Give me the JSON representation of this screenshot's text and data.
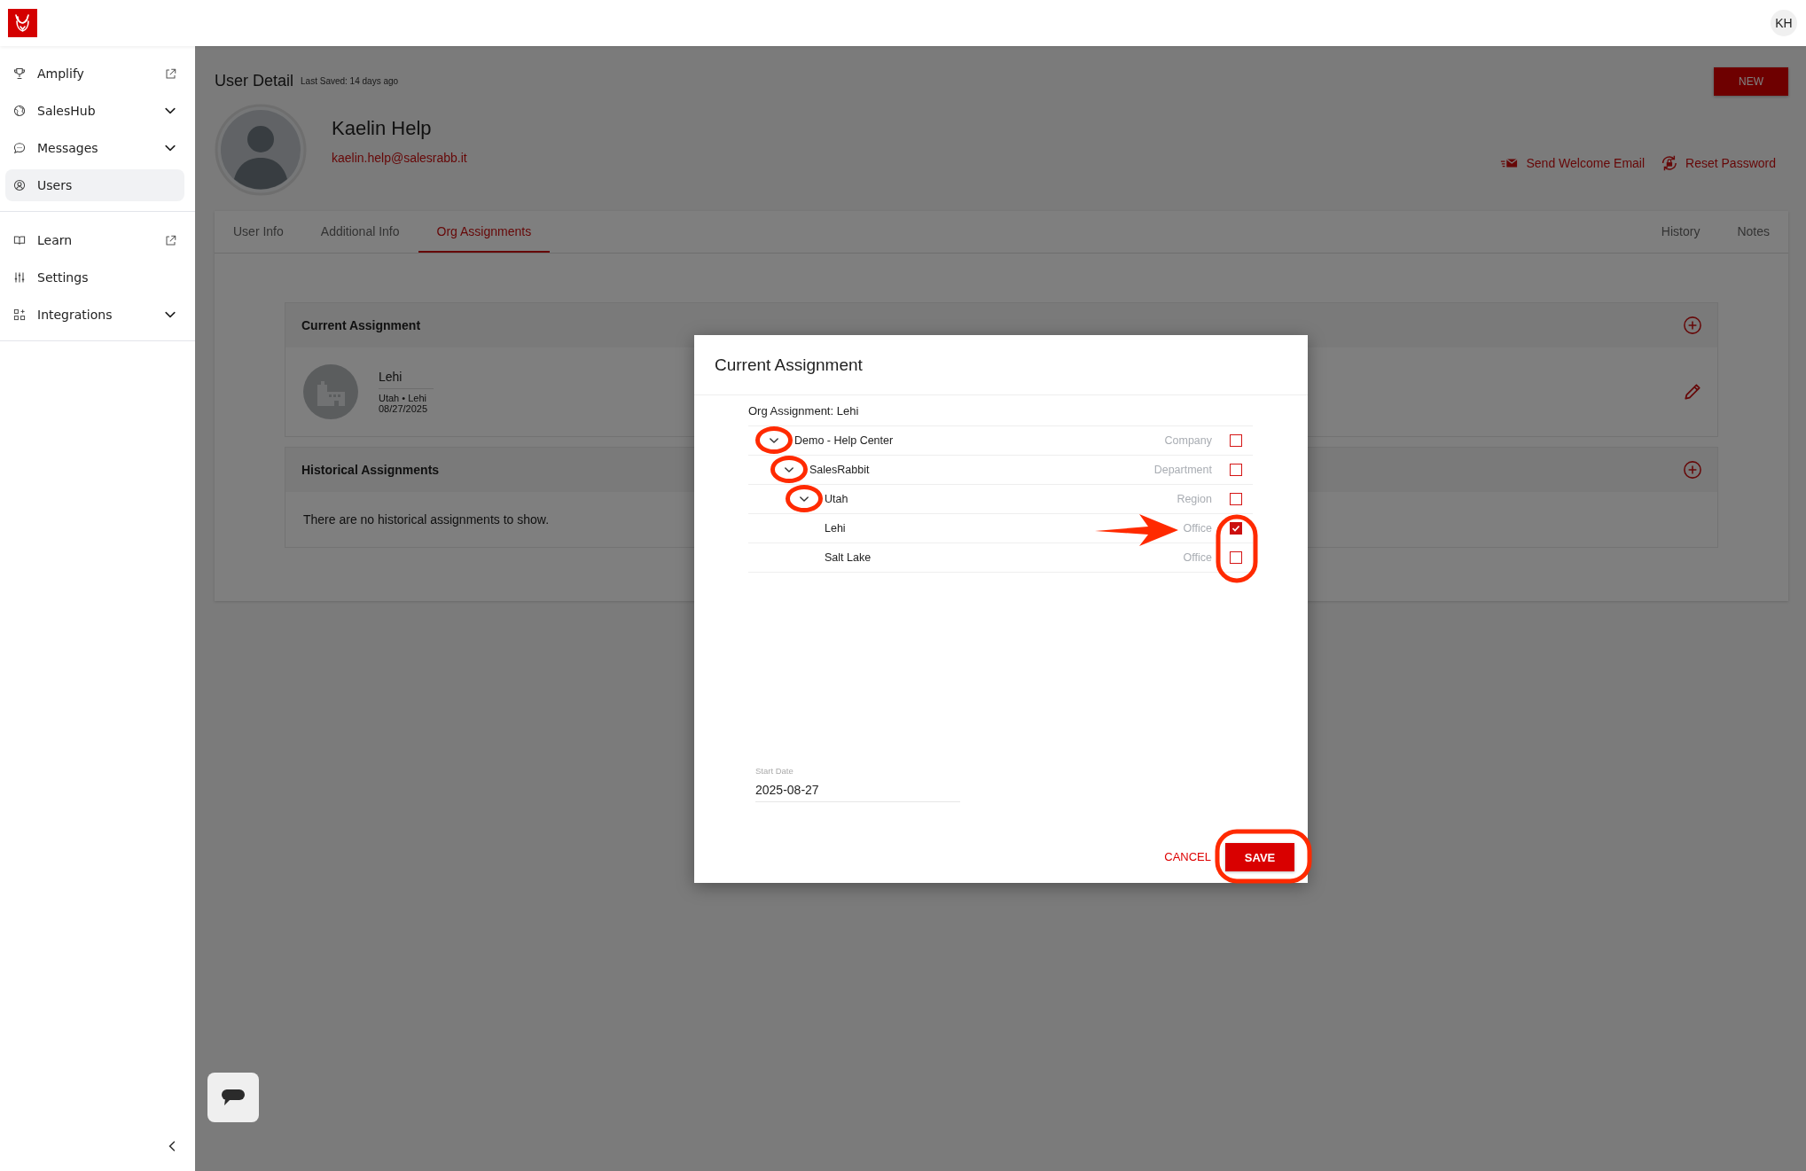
{
  "top_bar": {
    "avatar_initials": "KH"
  },
  "sidebar": {
    "groups": [
      {
        "items": [
          {
            "label": "Amplify",
            "kind": "external",
            "selected": false
          },
          {
            "label": "SalesHub",
            "kind": "expand",
            "selected": false
          },
          {
            "label": "Messages",
            "kind": "expand",
            "selected": false
          },
          {
            "label": "Users",
            "kind": "plain",
            "selected": true
          }
        ]
      },
      {
        "items": [
          {
            "label": "Learn",
            "kind": "external",
            "selected": false
          },
          {
            "label": "Settings",
            "kind": "plain",
            "selected": false
          },
          {
            "label": "Integrations",
            "kind": "expand",
            "selected": false
          }
        ]
      }
    ]
  },
  "page": {
    "title": "User Detail",
    "last_saved": "Last Saved:  14 days ago",
    "new_button": "NEW"
  },
  "user": {
    "name": "Kaelin Help",
    "email": "kaelin.help@salesrabb.it"
  },
  "actions": [
    "Send Welcome Email",
    "Reset Password"
  ],
  "tabs": {
    "left": [
      {
        "label": "User Info",
        "selected": false
      },
      {
        "label": "Additional Info",
        "selected": false
      },
      {
        "label": "Org Assignments",
        "selected": true
      }
    ],
    "right": [
      {
        "label": "History",
        "selected": false
      },
      {
        "label": "Notes",
        "selected": false
      }
    ]
  },
  "current_assignment": {
    "title": "Current Assignment",
    "name": "Lehi",
    "path": "Utah • Lehi",
    "date": "08/27/2025"
  },
  "historical_assignments": {
    "title": "Historical Assignments",
    "empty_text": "There are no historical assignments to show."
  },
  "dialog": {
    "title": "Current Assignment",
    "subtitle": "Org Assignment: Lehi",
    "tree": [
      {
        "label": "Demo - Help Center",
        "type": "Company",
        "checked": false,
        "expanded": true,
        "children": [
          {
            "label": "SalesRabbit",
            "type": "Department",
            "checked": false,
            "expanded": true,
            "children": [
              {
                "label": "Utah",
                "type": "Region",
                "checked": false,
                "expanded": true,
                "children": [
                  {
                    "label": "Lehi",
                    "type": "Office",
                    "checked": true
                  },
                  {
                    "label": "Salt Lake",
                    "type": "Office",
                    "checked": false
                  }
                ]
              }
            ]
          }
        ]
      }
    ],
    "start_date": {
      "label": "Start Date",
      "value": "2025-08-27"
    },
    "cancel_button": "CANCEL",
    "save_button": "SAVE"
  }
}
